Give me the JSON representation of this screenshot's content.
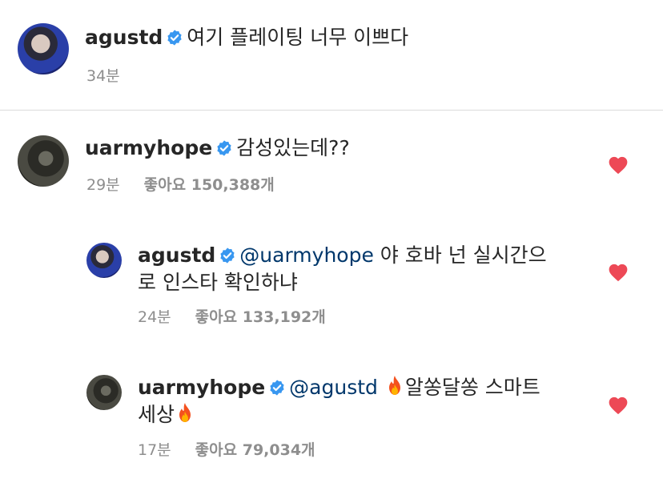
{
  "caption": {
    "username": "agustd",
    "text": "여기 플레이팅 너무 이쁘다",
    "time": "34분"
  },
  "comments": [
    {
      "username": "uarmyhope",
      "text": "감성있는데??",
      "time": "29분",
      "likes": "좋아요 150,388개"
    },
    {
      "username": "agustd",
      "mention": "@uarmyhope",
      "text_line1": "야 호바 넌 실시간으",
      "text_line2": "로 인스타 확인하냐",
      "time": "24분",
      "likes": "좋아요 133,192개"
    },
    {
      "username": "uarmyhope",
      "mention": "@agustd",
      "text_line1": "알쏭달쏭 스마트",
      "text_line2": "세상",
      "time": "17분",
      "likes": "좋아요 79,034개"
    }
  ],
  "colors": {
    "heart": "#ed4956",
    "verified": "#3897f0",
    "mention": "#00376b",
    "meta": "#8e8e8e"
  },
  "icons": [
    "verified-badge-icon",
    "heart-icon",
    "fire-emoji-icon"
  ]
}
